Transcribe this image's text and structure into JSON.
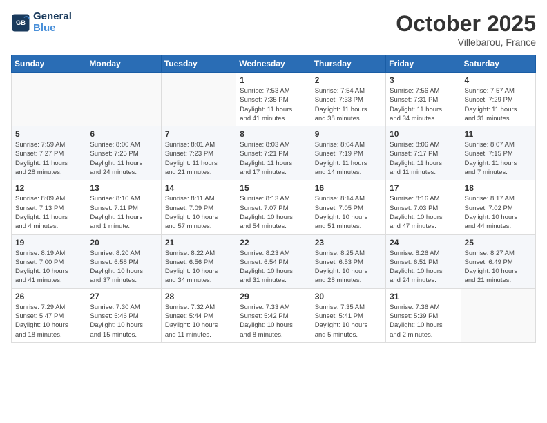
{
  "header": {
    "logo_line1": "General",
    "logo_line2": "Blue",
    "month": "October 2025",
    "location": "Villebarou, France"
  },
  "weekdays": [
    "Sunday",
    "Monday",
    "Tuesday",
    "Wednesday",
    "Thursday",
    "Friday",
    "Saturday"
  ],
  "weeks": [
    [
      {
        "day": "",
        "info": ""
      },
      {
        "day": "",
        "info": ""
      },
      {
        "day": "",
        "info": ""
      },
      {
        "day": "1",
        "info": "Sunrise: 7:53 AM\nSunset: 7:35 PM\nDaylight: 11 hours\nand 41 minutes."
      },
      {
        "day": "2",
        "info": "Sunrise: 7:54 AM\nSunset: 7:33 PM\nDaylight: 11 hours\nand 38 minutes."
      },
      {
        "day": "3",
        "info": "Sunrise: 7:56 AM\nSunset: 7:31 PM\nDaylight: 11 hours\nand 34 minutes."
      },
      {
        "day": "4",
        "info": "Sunrise: 7:57 AM\nSunset: 7:29 PM\nDaylight: 11 hours\nand 31 minutes."
      }
    ],
    [
      {
        "day": "5",
        "info": "Sunrise: 7:59 AM\nSunset: 7:27 PM\nDaylight: 11 hours\nand 28 minutes."
      },
      {
        "day": "6",
        "info": "Sunrise: 8:00 AM\nSunset: 7:25 PM\nDaylight: 11 hours\nand 24 minutes."
      },
      {
        "day": "7",
        "info": "Sunrise: 8:01 AM\nSunset: 7:23 PM\nDaylight: 11 hours\nand 21 minutes."
      },
      {
        "day": "8",
        "info": "Sunrise: 8:03 AM\nSunset: 7:21 PM\nDaylight: 11 hours\nand 17 minutes."
      },
      {
        "day": "9",
        "info": "Sunrise: 8:04 AM\nSunset: 7:19 PM\nDaylight: 11 hours\nand 14 minutes."
      },
      {
        "day": "10",
        "info": "Sunrise: 8:06 AM\nSunset: 7:17 PM\nDaylight: 11 hours\nand 11 minutes."
      },
      {
        "day": "11",
        "info": "Sunrise: 8:07 AM\nSunset: 7:15 PM\nDaylight: 11 hours\nand 7 minutes."
      }
    ],
    [
      {
        "day": "12",
        "info": "Sunrise: 8:09 AM\nSunset: 7:13 PM\nDaylight: 11 hours\nand 4 minutes."
      },
      {
        "day": "13",
        "info": "Sunrise: 8:10 AM\nSunset: 7:11 PM\nDaylight: 11 hours\nand 1 minute."
      },
      {
        "day": "14",
        "info": "Sunrise: 8:11 AM\nSunset: 7:09 PM\nDaylight: 10 hours\nand 57 minutes."
      },
      {
        "day": "15",
        "info": "Sunrise: 8:13 AM\nSunset: 7:07 PM\nDaylight: 10 hours\nand 54 minutes."
      },
      {
        "day": "16",
        "info": "Sunrise: 8:14 AM\nSunset: 7:05 PM\nDaylight: 10 hours\nand 51 minutes."
      },
      {
        "day": "17",
        "info": "Sunrise: 8:16 AM\nSunset: 7:03 PM\nDaylight: 10 hours\nand 47 minutes."
      },
      {
        "day": "18",
        "info": "Sunrise: 8:17 AM\nSunset: 7:02 PM\nDaylight: 10 hours\nand 44 minutes."
      }
    ],
    [
      {
        "day": "19",
        "info": "Sunrise: 8:19 AM\nSunset: 7:00 PM\nDaylight: 10 hours\nand 41 minutes."
      },
      {
        "day": "20",
        "info": "Sunrise: 8:20 AM\nSunset: 6:58 PM\nDaylight: 10 hours\nand 37 minutes."
      },
      {
        "day": "21",
        "info": "Sunrise: 8:22 AM\nSunset: 6:56 PM\nDaylight: 10 hours\nand 34 minutes."
      },
      {
        "day": "22",
        "info": "Sunrise: 8:23 AM\nSunset: 6:54 PM\nDaylight: 10 hours\nand 31 minutes."
      },
      {
        "day": "23",
        "info": "Sunrise: 8:25 AM\nSunset: 6:53 PM\nDaylight: 10 hours\nand 28 minutes."
      },
      {
        "day": "24",
        "info": "Sunrise: 8:26 AM\nSunset: 6:51 PM\nDaylight: 10 hours\nand 24 minutes."
      },
      {
        "day": "25",
        "info": "Sunrise: 8:27 AM\nSunset: 6:49 PM\nDaylight: 10 hours\nand 21 minutes."
      }
    ],
    [
      {
        "day": "26",
        "info": "Sunrise: 7:29 AM\nSunset: 5:47 PM\nDaylight: 10 hours\nand 18 minutes."
      },
      {
        "day": "27",
        "info": "Sunrise: 7:30 AM\nSunset: 5:46 PM\nDaylight: 10 hours\nand 15 minutes."
      },
      {
        "day": "28",
        "info": "Sunrise: 7:32 AM\nSunset: 5:44 PM\nDaylight: 10 hours\nand 11 minutes."
      },
      {
        "day": "29",
        "info": "Sunrise: 7:33 AM\nSunset: 5:42 PM\nDaylight: 10 hours\nand 8 minutes."
      },
      {
        "day": "30",
        "info": "Sunrise: 7:35 AM\nSunset: 5:41 PM\nDaylight: 10 hours\nand 5 minutes."
      },
      {
        "day": "31",
        "info": "Sunrise: 7:36 AM\nSunset: 5:39 PM\nDaylight: 10 hours\nand 2 minutes."
      },
      {
        "day": "",
        "info": ""
      }
    ]
  ]
}
